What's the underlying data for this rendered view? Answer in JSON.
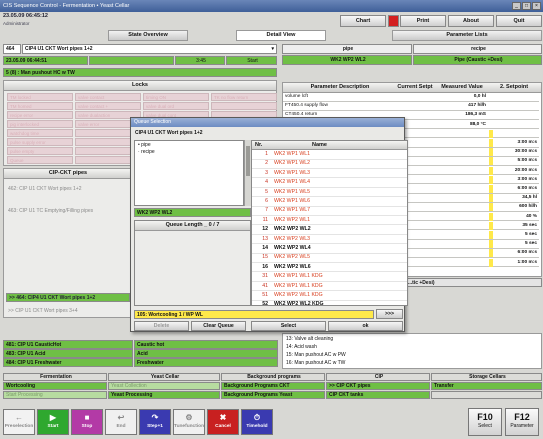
{
  "window": {
    "title": "CIS Sequence Control - Fermentation • Yeast Cellar",
    "datetime": "23.05.09 06:45:12",
    "user": "Administrator"
  },
  "toolbar": {
    "chart": "Chart",
    "print": "Print",
    "about": "About",
    "quit": "Quit"
  },
  "tabs": {
    "state_overview": "State Overview",
    "detail_view": "Detail View",
    "parameter_lists": "Parameter Lists"
  },
  "object": {
    "id": "464",
    "name": "CIP4 U1 CKT Wort pipes 1+2",
    "date": "23.05.09 06:44:51",
    "duration": "3:45",
    "start_label": "Start",
    "step": "5 (8) : Man pushout HC w TW"
  },
  "pipe_recipe": {
    "pipe_header": "pipe",
    "recipe_header": "recipe",
    "pipe_value": "WK2 WP2 WL2",
    "recipe_value": "Pipe (Caustic +Desi)"
  },
  "locks": {
    "title": "Locks",
    "items": [
      "TM locked",
      "valve contact",
      "timing ON",
      "TK no flow return",
      "TM homed",
      "valve contact +",
      "valve dual ord",
      "",
      "recipe error",
      "valve dualaction",
      "valve dual cont",
      "",
      "pig interlocked",
      "valve error",
      "",
      "",
      "watchdog time",
      "",
      "",
      "",
      "pulse supply error",
      "",
      "",
      "",
      "pulse empty",
      "",
      "",
      "",
      "Queue",
      "",
      "",
      ""
    ]
  },
  "cip_pipes": {
    "title": "CIP-CKT pipes",
    "items": [
      "462: CIP U1 CKT Wort pipes 1+2",
      "463: CIP U1 TC Emptying/Filling pipes",
      ">> 464: CIP4 U1 CKT Wort pipes 1+2",
      ">> CIP U1 CKT Wort pipes 3+4"
    ]
  },
  "params": {
    "headers": [
      "Parameter Description",
      "Current Setpt",
      "Measured Value",
      "2. Setpoint"
    ],
    "rows": [
      {
        "d": "volume lcft",
        "c": "",
        "m": "0,0 hl",
        "s": ""
      },
      {
        "d": "FT450.4 supply flow",
        "c": "",
        "m": "417 hl/h",
        "s": ""
      },
      {
        "d": "CT450.4 return",
        "c": "",
        "m": "186,3 mS",
        "s": ""
      },
      {
        "d": "TT450.4 return",
        "c": "",
        "m": "88,0 °C",
        "s": ""
      },
      {
        "d": "",
        "c": "",
        "m": "",
        "s": ""
      },
      {
        "d": "",
        "c": "",
        "m": "",
        "s": "3:00 m:s"
      },
      {
        "d": "",
        "c": "",
        "m": "",
        "s": "30:00 m:s"
      },
      {
        "d": "",
        "c": "",
        "m": "",
        "s": "5:00 m:s"
      },
      {
        "d": "",
        "c": "",
        "m": "",
        "s": "20:00 m:s"
      },
      {
        "d": "",
        "c": "",
        "m": "",
        "s": "3:00 m:s"
      },
      {
        "d": "",
        "c": "",
        "m": "",
        "s": "6:00 m:s"
      },
      {
        "d": "",
        "c": "",
        "m": "",
        "s": "34,5 hl"
      },
      {
        "d": "",
        "c": "",
        "m": "",
        "s": "600 hl/h"
      },
      {
        "d": "",
        "c": "",
        "m": "",
        "s": "40 %"
      },
      {
        "d": "",
        "c": "",
        "m": "",
        "s": "35 sec"
      },
      {
        "d": "",
        "c": "",
        "m": "",
        "s": "5 sec"
      },
      {
        "d": "",
        "c": "",
        "m": "",
        "s": "5 sec"
      },
      {
        "d": "",
        "c": "",
        "m": "",
        "s": "6:00 m:s"
      },
      {
        "d": "",
        "c": "",
        "m": "",
        "s": "1:00 m:s"
      }
    ],
    "recipe_hdr": "...tic +Desi)"
  },
  "steps": {
    "items": [
      "13: Valve alt cleaning",
      "14: Acid wash",
      "15: Man pushout AC w PW",
      "16: Man pushout AC w TW"
    ]
  },
  "units": {
    "items": [
      {
        "name": "481: CIP U1 CausticHot",
        "value": "Caustic hot"
      },
      {
        "name": "483: CIP U1 Acid",
        "value": "Acid"
      },
      {
        "name": "484: CIP U1 Freshwater",
        "value": "Freshwater"
      }
    ]
  },
  "dialog": {
    "title": "Queue Selection",
    "object": "CIP4 U1 CKT Wort pipes 1+2",
    "tree": [
      "pipe",
      "recipe"
    ],
    "selected_pipe": "WK2 WP2 WL2",
    "queue_length": "Queue Length _ 0 / 7",
    "list_headers": {
      "no": "Nr.",
      "name": "Name"
    },
    "rows": [
      {
        "no": "1",
        "name": "WK2 WP1 WL1",
        "active": false
      },
      {
        "no": "2",
        "name": "WK2 WP1 WL2",
        "active": false
      },
      {
        "no": "3",
        "name": "WK2 WP1 WL3",
        "active": false
      },
      {
        "no": "4",
        "name": "WK2 WP1 WL4",
        "active": false
      },
      {
        "no": "5",
        "name": "WK2 WP1 WL5",
        "active": false
      },
      {
        "no": "6",
        "name": "WK2 WP1 WL6",
        "active": false
      },
      {
        "no": "7",
        "name": "WK2 WP1 WL7",
        "active": false
      },
      {
        "no": "11",
        "name": "WK2 WP2 WL1",
        "active": false
      },
      {
        "no": "12",
        "name": "WK2 WP2 WL2",
        "active": true
      },
      {
        "no": "13",
        "name": "WK2 WP2 WL3",
        "active": false
      },
      {
        "no": "14",
        "name": "WK2 WP2 WL4",
        "active": true
      },
      {
        "no": "15",
        "name": "WK2 WP2 WL5",
        "active": false
      },
      {
        "no": "16",
        "name": "WK2 WP2 WL6",
        "active": true
      },
      {
        "no": "31",
        "name": "WK2 WP1 WL1 KDG",
        "active": false
      },
      {
        "no": "41",
        "name": "WK2 WP1 WL1 KDG",
        "active": false
      },
      {
        "no": "51",
        "name": "WK2 WP2 WL1 KDG",
        "active": false
      },
      {
        "no": "52",
        "name": "WK2 WP2 WL2 KDG",
        "active": true
      }
    ],
    "status": "105: Wortcooling 1 / WP WL",
    "nav_btn": ">>>",
    "buttons": {
      "delete": "Delete",
      "clear": "Clear Queue",
      "select": "Select",
      "ok": "ok"
    }
  },
  "bottom_tabs": {
    "headers": [
      "Fermentation",
      "Yeast Cellar",
      "Background programs",
      "CIP",
      "Storage Cellars"
    ],
    "row1": [
      "Wortcooling",
      "Yeast Collection",
      "Background Programs CKT",
      ">> CIP CKT pipes",
      "Transfer"
    ],
    "row2": [
      "Start Processing",
      "Yeast Processing",
      "Background Programs Yeast",
      "CIP CKT tanks",
      ""
    ]
  },
  "fkeys": [
    {
      "label": "Preselection",
      "color": "#f2f2f2",
      "icon": "←"
    },
    {
      "label": "Start",
      "color": "#2fa82f",
      "icon": "▶"
    },
    {
      "label": "Stop",
      "color": "#b33aa6",
      "icon": "■"
    },
    {
      "label": "End",
      "color": "#f0f0f0",
      "icon": "↩"
    },
    {
      "label": "Step+1",
      "color": "#3a3ab0",
      "icon": "↷"
    },
    {
      "label": "Tunefunction",
      "color": "#f0f0f0",
      "icon": "⚙"
    },
    {
      "label": "Cancel",
      "color": "#c82020",
      "icon": "✖"
    },
    {
      "label": "Timehold",
      "color": "#3a3ab0",
      "icon": "⏱"
    }
  ],
  "fbig": [
    {
      "key": "F10",
      "label": "Select"
    },
    {
      "key": "F12",
      "label": "Parameter"
    }
  ]
}
